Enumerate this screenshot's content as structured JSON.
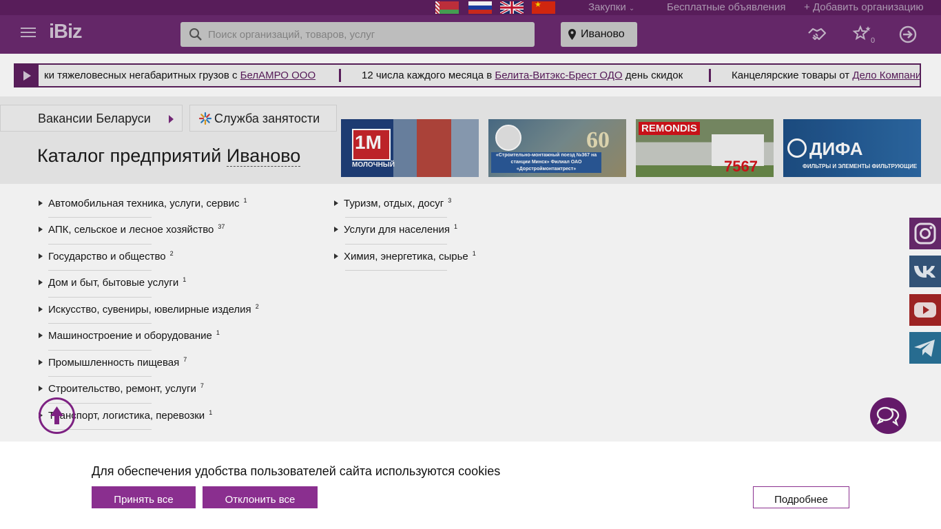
{
  "topbar": {
    "languages": [
      "Беларуский",
      "Русский",
      "English",
      "中文"
    ],
    "purchases_label": "Закупки",
    "free_ads_label": "Бесплатные объявления",
    "add_org_label": "Добавить организацию"
  },
  "header": {
    "logo": "iBiz",
    "search_placeholder": "Поиск организаций, товаров, услуг",
    "city": "Иваново",
    "favorites_count": "0"
  },
  "ticker": {
    "items": [
      {
        "text": "ки тяжеловесных негабаритных грузов с ",
        "link": "БелАМРО ООО",
        "after": ""
      },
      {
        "text": "12 числа каждого месяца в ",
        "link": "Белита-Витэкс-Брест ОДО",
        "after": " день скидок"
      },
      {
        "text": "Канцелярские товары от ",
        "link": "Дело Компании",
        "after": ""
      }
    ]
  },
  "tabs": {
    "vacancies": "Вакансии Беларуси",
    "employment": "Служба занятости"
  },
  "page_title": {
    "prefix": "Каталог предприятий",
    "city": "Иваново"
  },
  "banners": [
    {
      "name": "1М",
      "sub": "МОЛОЧНЫЙ"
    },
    {
      "name": "60",
      "sub": "«Строительно-монтажный поезд №367 на станции Минск» Филиал ОАО «Дорстроймонтажтрест»"
    },
    {
      "name": "REMONDIS",
      "sub": "7567"
    },
    {
      "name": "ДИФА",
      "sub": "ФИЛЬТРЫ И ЭЛЕМЕНТЫ ФИЛЬТРУЮЩИЕ"
    }
  ],
  "categories_left": [
    {
      "label": "Автомобильная техника, услуги, сервис",
      "count": "1"
    },
    {
      "label": "АПК, сельское и лесное хозяйство",
      "count": "37"
    },
    {
      "label": "Государство и общество",
      "count": "2"
    },
    {
      "label": "Дом и быт, бытовые услуги",
      "count": "1"
    },
    {
      "label": "Искусство, сувениры, ювелирные изделия",
      "count": "2"
    },
    {
      "label": "Машиностроение и оборудование",
      "count": "1"
    },
    {
      "label": "Промышленность пищевая",
      "count": "7"
    },
    {
      "label": "Строительство, ремонт, услуги",
      "count": "7"
    },
    {
      "label": "Транспорт, логистика, перевозки",
      "count": "1"
    }
  ],
  "categories_right": [
    {
      "label": "Туризм, отдых, досуг",
      "count": "3"
    },
    {
      "label": "Услуги для населения",
      "count": "1"
    },
    {
      "label": "Химия, энергетика, сырье",
      "count": "1"
    }
  ],
  "social": [
    "instagram-icon",
    "vk-icon",
    "youtube-icon",
    "telegram-icon"
  ],
  "cookie": {
    "text": "Для обеспечения удобства пользователей сайта используются cookies",
    "accept": "Принять все",
    "decline": "Отклонить все",
    "more": "Подробнее"
  }
}
